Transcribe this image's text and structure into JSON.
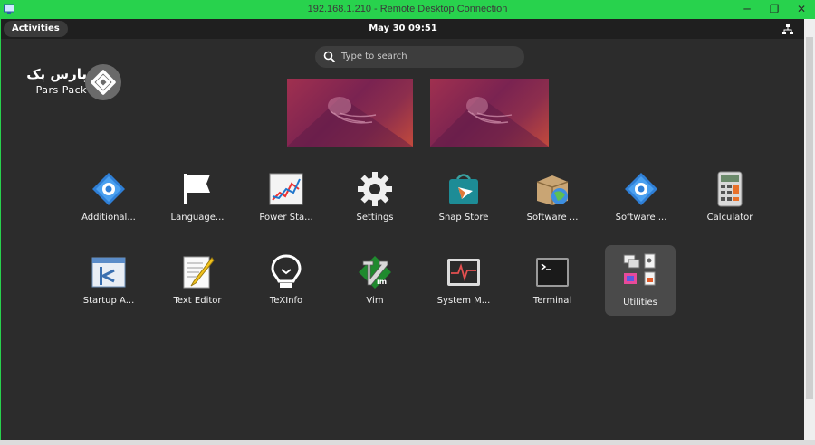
{
  "window": {
    "title": "192.168.1.210 - Remote Desktop Connection",
    "minimize_glyph": "─",
    "restore_glyph": "❐",
    "close_glyph": "✕"
  },
  "topbar": {
    "activities_label": "Activities",
    "clock": "May 30  09:51"
  },
  "watermark": {
    "name_fa": "پارس پک",
    "name_en": "Pars Pack"
  },
  "search": {
    "placeholder": "Type to search"
  },
  "workspaces": [
    {
      "name": "workspace-1"
    },
    {
      "name": "workspace-2"
    }
  ],
  "apps_row1": [
    {
      "label": "Additional...",
      "icon": "additional-drivers-icon"
    },
    {
      "label": "Language...",
      "icon": "language-support-icon"
    },
    {
      "label": "Power Sta...",
      "icon": "power-statistics-icon"
    },
    {
      "label": "Settings",
      "icon": "settings-icon"
    },
    {
      "label": "Snap Store",
      "icon": "snap-store-icon"
    },
    {
      "label": "Software ...",
      "icon": "software-updater-icon"
    },
    {
      "label": "Software ...",
      "icon": "software-properties-icon"
    },
    {
      "label": "Calculator",
      "icon": "calculator-icon"
    }
  ],
  "apps_row2": [
    {
      "label": "Startup A...",
      "icon": "startup-applications-icon"
    },
    {
      "label": "Text Editor",
      "icon": "text-editor-icon"
    },
    {
      "label": "TeXInfo",
      "icon": "texinfo-icon"
    },
    {
      "label": "Vim",
      "icon": "vim-icon"
    },
    {
      "label": "System M...",
      "icon": "system-monitor-icon"
    },
    {
      "label": "Terminal",
      "icon": "terminal-icon"
    },
    {
      "label": "Utilities",
      "icon": "utilities-folder-icon"
    }
  ],
  "colors": {
    "rdp_titlebar": "#28d24d",
    "topbar": "#1f1f1f",
    "overview_bg": "#2c2c2c",
    "wallpaper_primary": "#7a2351"
  }
}
